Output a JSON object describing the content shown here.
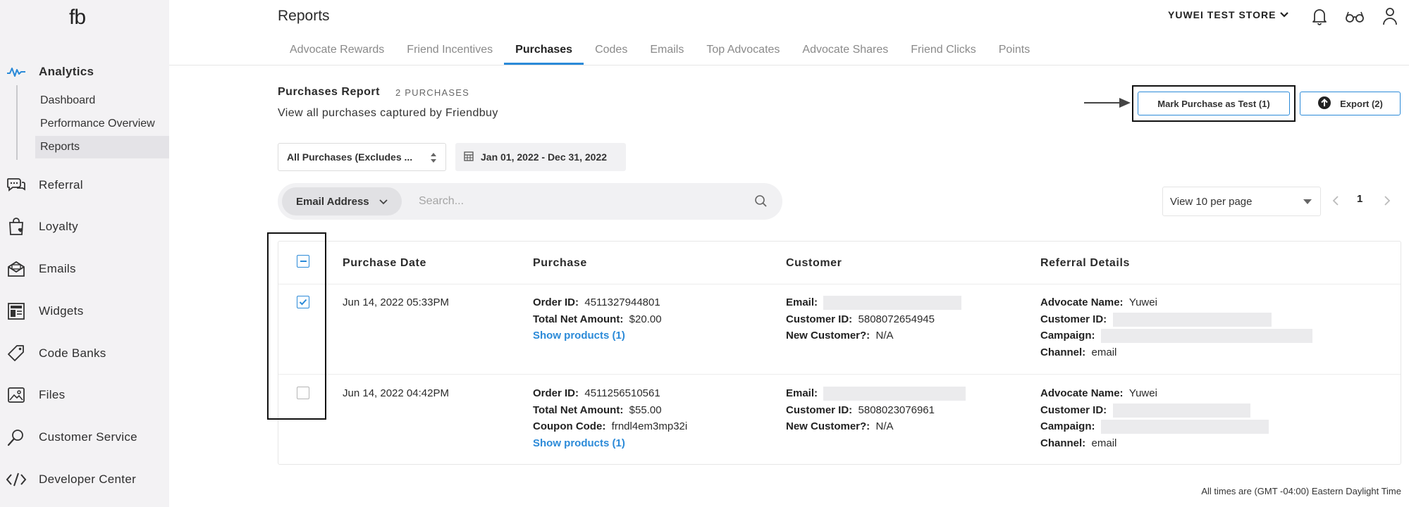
{
  "sidebar": {
    "logo": "fb",
    "analytics": {
      "label": "Analytics",
      "icon": "analytics-wave-icon",
      "children": [
        "Dashboard",
        "Performance Overview",
        "Reports"
      ]
    },
    "items": [
      {
        "label": "Referral",
        "icon": "chat-bubbles-icon"
      },
      {
        "label": "Loyalty",
        "icon": "shopping-bag-heart-icon"
      },
      {
        "label": "Emails",
        "icon": "envelope-open-icon"
      },
      {
        "label": "Widgets",
        "icon": "widget-layout-icon"
      },
      {
        "label": "Code Banks",
        "icon": "tag-icon"
      },
      {
        "label": "Files",
        "icon": "image-file-icon"
      },
      {
        "label": "Customer Service",
        "icon": "magnifier-icon"
      },
      {
        "label": "Developer Center",
        "icon": "code-brackets-icon"
      }
    ]
  },
  "header": {
    "title": "Reports",
    "store": "YUWEI TEST STORE",
    "icons": [
      "bell-icon",
      "glasses-icon",
      "user-icon"
    ]
  },
  "tabs": [
    {
      "label": "Advocate Rewards",
      "active": false
    },
    {
      "label": "Friend Incentives",
      "active": false
    },
    {
      "label": "Purchases",
      "active": true
    },
    {
      "label": "Codes",
      "active": false
    },
    {
      "label": "Emails",
      "active": false
    },
    {
      "label": "Top Advocates",
      "active": false
    },
    {
      "label": "Advocate Shares",
      "active": false
    },
    {
      "label": "Friend Clicks",
      "active": false
    },
    {
      "label": "Points",
      "active": false
    }
  ],
  "report": {
    "title": "Purchases Report",
    "count": "2 PURCHASES",
    "subtitle": "View all purchases captured by Friendbuy"
  },
  "actions": {
    "mark_test": "Mark Purchase as Test (1)",
    "export": "Export (2)"
  },
  "filters": {
    "purchase_type": "All Purchases (Excludes ...",
    "date_range": "Jan 01, 2022 - Dec 31, 2022"
  },
  "search": {
    "field": "Email Address",
    "placeholder": "Search..."
  },
  "pagination": {
    "per_page": "View 10 per page",
    "page": "1"
  },
  "table": {
    "columns": [
      "Purchase Date",
      "Purchase",
      "Customer",
      "Referral Details"
    ],
    "rows": [
      {
        "checked": true,
        "date": "Jun 14, 2022 05:33PM",
        "order_id_label": "Order ID:",
        "order_id": "4511327944801",
        "net_label": "Total Net Amount:",
        "net": "$20.00",
        "show_products": "Show products (1)",
        "email_label": "Email:",
        "customer_id_label": "Customer ID:",
        "customer_id": "5808072654945",
        "new_customer_label": "New Customer?:",
        "new_customer": "N/A",
        "advocate_label": "Advocate Name:",
        "advocate": "Yuwei",
        "ref_customer_id_label": "Customer ID:",
        "campaign_label": "Campaign:",
        "channel_label": "Channel:",
        "channel": "email"
      },
      {
        "checked": false,
        "date": "Jun 14, 2022 04:42PM",
        "order_id_label": "Order ID:",
        "order_id": "4511256510561",
        "net_label": "Total Net Amount:",
        "net": "$55.00",
        "coupon_label": "Coupon Code:",
        "coupon": "frndl4em3mp32i",
        "show_products": "Show products (1)",
        "email_label": "Email:",
        "customer_id_label": "Customer ID:",
        "customer_id": "5808023076961",
        "new_customer_label": "New Customer?:",
        "new_customer": "N/A",
        "advocate_label": "Advocate Name:",
        "advocate": "Yuwei",
        "ref_customer_id_label": "Customer ID:",
        "campaign_label": "Campaign:",
        "channel_label": "Channel:",
        "channel": "email"
      }
    ]
  },
  "footnote": "All times are (GMT -04:00) Eastern Daylight Time",
  "colors": {
    "accent": "#2b8ad8",
    "sidebar_bg": "#f3f2f4"
  }
}
